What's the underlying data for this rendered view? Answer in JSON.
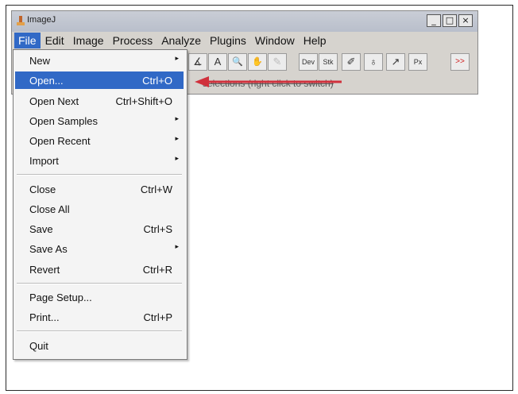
{
  "window": {
    "title": "ImageJ",
    "minimize": "_",
    "maximize": "□",
    "close": "×"
  },
  "menubar": {
    "items": [
      "File",
      "Edit",
      "Image",
      "Process",
      "Analyze",
      "Plugins",
      "Window",
      "Help"
    ],
    "active": "File"
  },
  "toolbar": {
    "tools": [
      {
        "name": "angle-tool-icon",
        "glyph": "∡"
      },
      {
        "name": "text-tool-icon",
        "glyph": "A"
      },
      {
        "name": "magnifier-tool-icon",
        "glyph": "🔍"
      },
      {
        "name": "hand-tool-icon",
        "glyph": "✋"
      },
      {
        "name": "color-picker-tool-icon",
        "glyph": "✎"
      },
      {
        "name": "dev-tool-icon",
        "glyph": "Dev"
      },
      {
        "name": "stk-tool-icon",
        "glyph": "Stk"
      },
      {
        "name": "brush-tool-icon",
        "glyph": "✐"
      },
      {
        "name": "flood-fill-tool-icon",
        "glyph": "♁"
      },
      {
        "name": "arrow-tool-icon",
        "glyph": "↗"
      },
      {
        "name": "pixel-inspector-icon",
        "glyph": "Px"
      },
      {
        "name": "more-tools-icon",
        "glyph": ">>"
      }
    ]
  },
  "status": {
    "text": "selections (right click to switch)"
  },
  "file_menu": {
    "items": [
      {
        "label": "New",
        "shortcut": "",
        "submenu": true
      },
      {
        "label": "Open...",
        "shortcut": "Ctrl+O",
        "submenu": false,
        "selected": true
      },
      {
        "label": "Open Next",
        "shortcut": "Ctrl+Shift+O",
        "submenu": false
      },
      {
        "label": "Open Samples",
        "shortcut": "",
        "submenu": true
      },
      {
        "label": "Open Recent",
        "shortcut": "",
        "submenu": true
      },
      {
        "label": "Import",
        "shortcut": "",
        "submenu": true
      },
      {
        "label": "Close",
        "shortcut": "Ctrl+W",
        "submenu": false
      },
      {
        "label": "Close All",
        "shortcut": "",
        "submenu": false
      },
      {
        "label": "Save",
        "shortcut": "Ctrl+S",
        "submenu": false
      },
      {
        "label": "Save As",
        "shortcut": "",
        "submenu": true
      },
      {
        "label": "Revert",
        "shortcut": "Ctrl+R",
        "submenu": false
      },
      {
        "label": "Page Setup...",
        "shortcut": "",
        "submenu": false
      },
      {
        "label": "Print...",
        "shortcut": "Ctrl+P",
        "submenu": false
      },
      {
        "label": "Quit",
        "shortcut": "",
        "submenu": false
      }
    ],
    "submenu_glyph": "▸"
  },
  "colors": {
    "selection": "#3169c6",
    "annotation_arrow": "#d0313c"
  }
}
